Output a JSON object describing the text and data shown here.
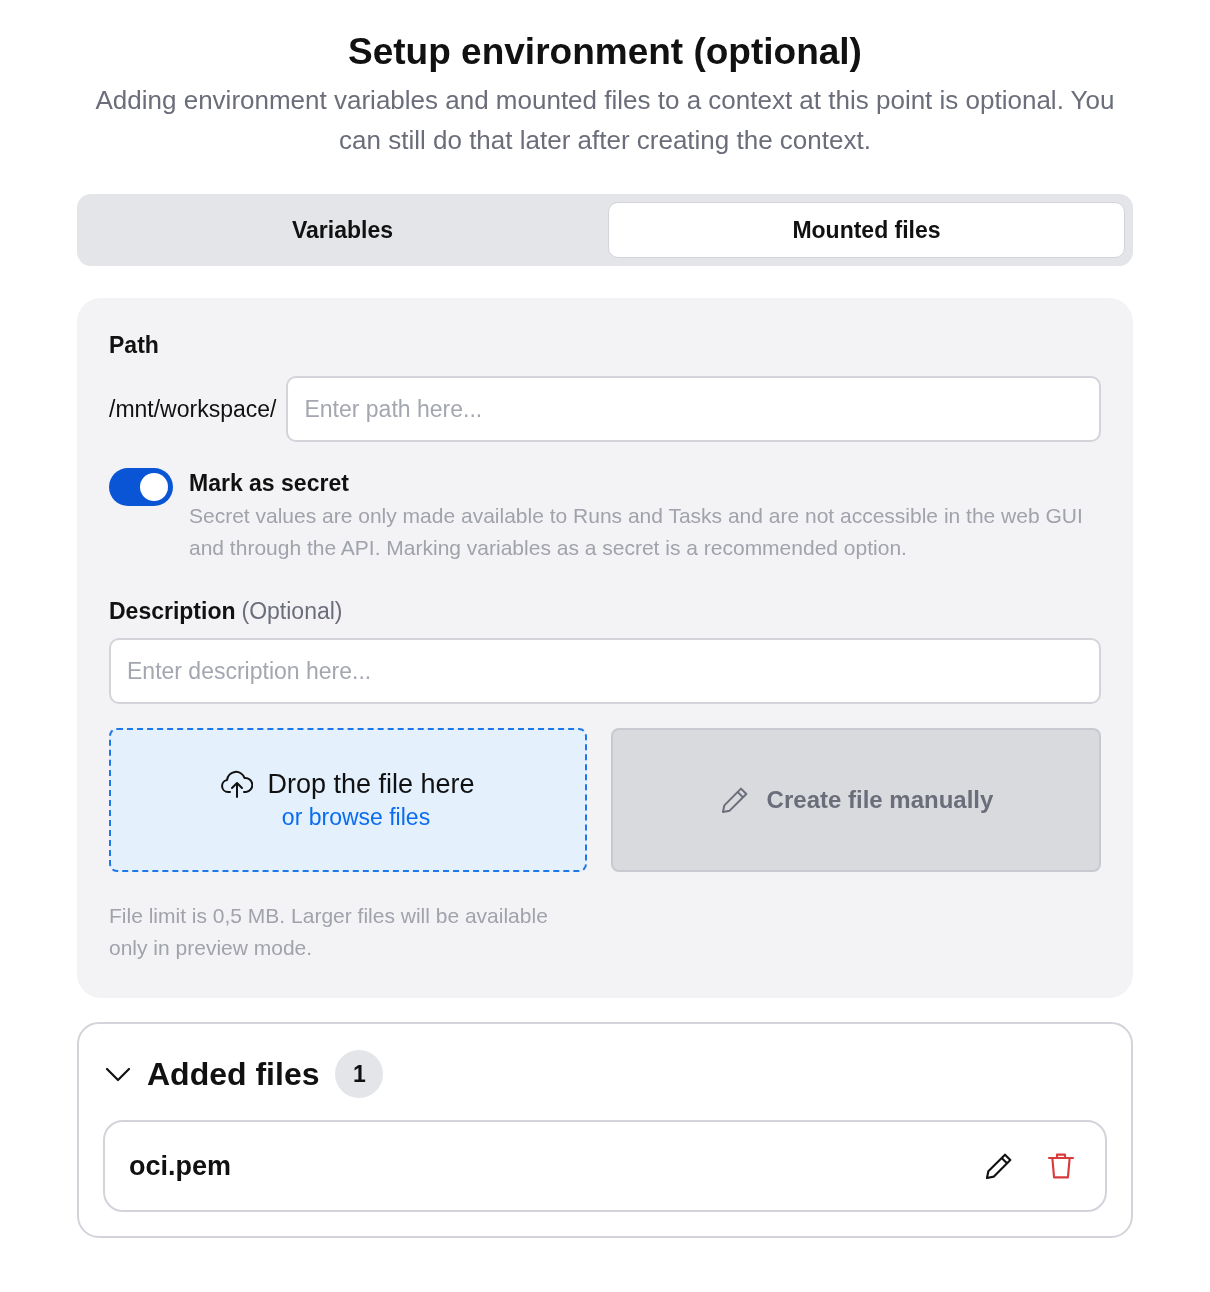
{
  "header": {
    "title": "Setup environment (optional)",
    "subtitle": "Adding environment variables and mounted files to a context at this point is optional. You can still do that later after creating the context."
  },
  "tabs": [
    {
      "label": "Variables",
      "selected": false
    },
    {
      "label": "Mounted files",
      "selected": true
    }
  ],
  "path": {
    "label": "Path",
    "prefix": "/mnt/workspace/",
    "placeholder": "Enter path here..."
  },
  "secret": {
    "label": "Mark as secret",
    "on": true,
    "help": "Secret values are only made available to Runs and Tasks and are not accessible in the web GUI and through the API. Marking variables as a secret is a recommended option."
  },
  "description": {
    "label": "Description",
    "optional": "(Optional)",
    "placeholder": "Enter description here..."
  },
  "dropzone": {
    "title": "Drop the file here",
    "link": "or browse files"
  },
  "create_button": {
    "label": "Create file manually"
  },
  "file_limit": "File limit is 0,5 MB. Larger files will be available only in preview mode.",
  "added_files": {
    "title": "Added files",
    "count": "1",
    "expanded": true,
    "files": [
      {
        "name": "oci.pem"
      }
    ]
  }
}
